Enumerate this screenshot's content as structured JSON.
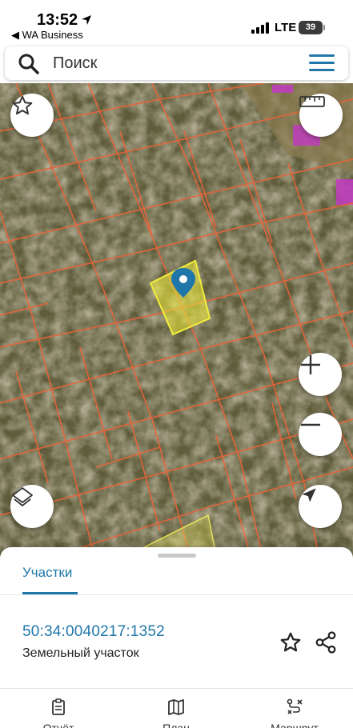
{
  "status_bar": {
    "time": "13:52",
    "back_app": "◀ WA Business",
    "network": "LTE",
    "battery": "39"
  },
  "search": {
    "placeholder": "Поиск"
  },
  "bottom_sheet": {
    "tab_label": "Участки",
    "parcel": {
      "number": "50:34:0040217:1352",
      "type": "Земельный участок"
    }
  },
  "bottom_nav": [
    {
      "label": "Отчёт",
      "icon": "report-icon"
    },
    {
      "label": "План",
      "icon": "map-icon"
    },
    {
      "label": "Маршрут",
      "icon": "route-icon"
    }
  ],
  "colors": {
    "accent": "#1f77a9",
    "parcel_border": "#e8643a",
    "selected_parcel": "#f2ee3c",
    "marker": "#1f77a9"
  }
}
